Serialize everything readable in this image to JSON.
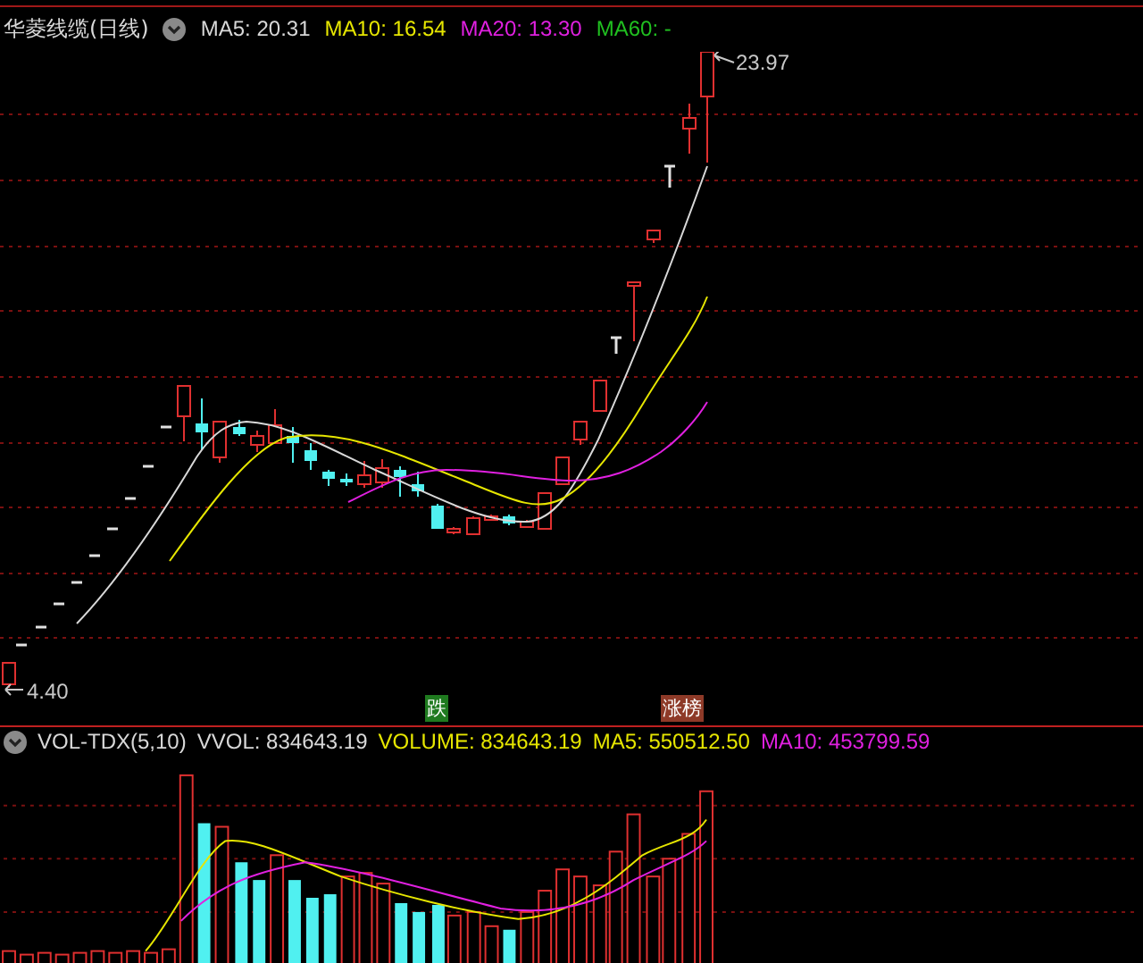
{
  "title": "华菱线缆(日线)",
  "ma_legend": [
    {
      "label": "MA5: 20.31",
      "color": "#d8d8d8"
    },
    {
      "label": "MA10: 16.54",
      "color": "#e6e600"
    },
    {
      "label": "MA20: 13.30",
      "color": "#e020e0"
    },
    {
      "label": "MA60: -",
      "color": "#20c020"
    }
  ],
  "high_price": "23.97",
  "low_price": "4.40",
  "badges": [
    {
      "text": "跌",
      "color": "#1f7a1f"
    },
    {
      "text": "涨榜",
      "color": "#8e3a28"
    }
  ],
  "volume_indicator": "VOL-TDX(5,10)",
  "volume_legend": [
    {
      "label": "VVOL: 834643.19",
      "color": "#d8d8d8"
    },
    {
      "label": "VOLUME: 834643.19",
      "color": "#e6e600"
    },
    {
      "label": "MA5: 550512.50",
      "color": "#e6e600"
    },
    {
      "label": "MA10: 453799.59",
      "color": "#e020e0"
    }
  ]
}
